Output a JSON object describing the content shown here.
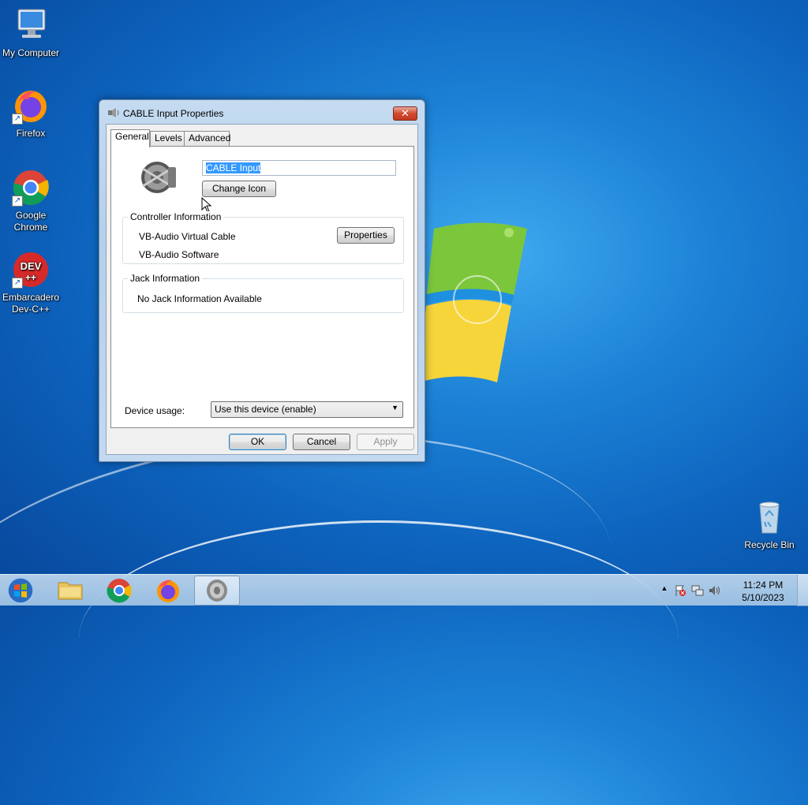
{
  "desktop": {
    "icons": [
      {
        "label": "My Computer",
        "icon": "computer-icon"
      },
      {
        "label": "Firefox",
        "icon": "firefox-icon"
      },
      {
        "label": "Google Chrome",
        "icon": "chrome-icon"
      },
      {
        "label": "Embarcadero Dev-C++",
        "icon": "devcpp-icon"
      },
      {
        "label": "Recycle Bin",
        "icon": "recycle-bin-icon"
      }
    ],
    "devcpp_logo_text": "DEV"
  },
  "dialog": {
    "title": "CABLE Input Properties",
    "close_glyph": "✕",
    "tabs": [
      "General",
      "Levels",
      "Advanced"
    ],
    "active_tab": "General",
    "device_name": "CABLE Input",
    "change_icon_label": "Change Icon",
    "controller": {
      "heading": "Controller Information",
      "name": "VB-Audio Virtual Cable",
      "vendor": "VB-Audio Software",
      "properties_label": "Properties"
    },
    "jack": {
      "heading": "Jack Information",
      "text": "No Jack Information Available"
    },
    "device_usage": {
      "label": "Device usage:",
      "value": "Use this device (enable)"
    },
    "buttons": {
      "ok": "OK",
      "cancel": "Cancel",
      "apply": "Apply"
    }
  },
  "taskbar": {
    "clock_time": "11:24 PM",
    "clock_date": "5/10/2023",
    "tray_chevron": "▲"
  },
  "colors": {
    "selection": "#3399ff",
    "desktop_blue": "#1c82d6"
  }
}
